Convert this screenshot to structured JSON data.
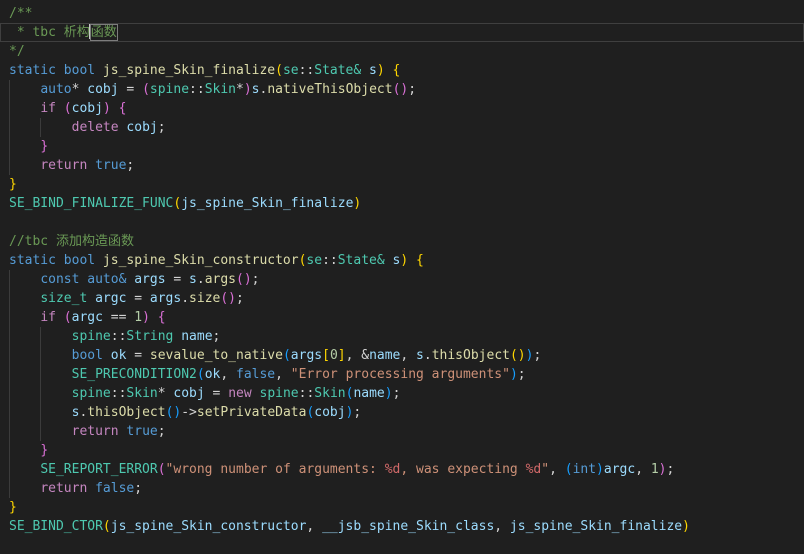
{
  "editor": {
    "description": "dark code editor viewport showing C++ spine Skin JS-binding code, no gutter visible",
    "palette": {
      "bg": "#1f1f1f",
      "fg": "#d4d4d4",
      "guide": "#3b3b3b",
      "lineBorder": "#3f3f3f",
      "cursor": "#c8c8c8",
      "imeBox": "#7d7d7d",
      "cm": "#6a9955",
      "kw": "#569cd6",
      "ct": "#c586c0",
      "fn": "#dcdcaa",
      "ty": "#4ec9b0",
      "vr": "#9cdcfe",
      "nu": "#b5cea8",
      "st": "#ce9178",
      "fm": "#d16969",
      "b1": "#ffd700",
      "b2": "#da70d6",
      "b3": "#179fff"
    },
    "cursor_line": 2,
    "lines": [
      {
        "indent": 0,
        "segments": [
          [
            "cm",
            "/**"
          ]
        ]
      },
      {
        "indent": 0,
        "current": true,
        "segments": [
          [
            "cm",
            " * tbc 析构"
          ],
          [
            "cur",
            ""
          ],
          [
            "cmx",
            "函数"
          ]
        ]
      },
      {
        "indent": 0,
        "segments": [
          [
            "cm",
            "*/"
          ]
        ]
      },
      {
        "indent": 0,
        "segments": [
          [
            "kw",
            "static bool"
          ],
          [
            "pl",
            " "
          ],
          [
            "fn",
            "js_spine_Skin_finalize"
          ],
          [
            "b1",
            "("
          ],
          [
            "ty",
            "se"
          ],
          [
            "pl",
            "::"
          ],
          [
            "ty",
            "State&"
          ],
          [
            "pl",
            " "
          ],
          [
            "vr",
            "s"
          ],
          [
            "b1",
            ")"
          ],
          [
            "pl",
            " "
          ],
          [
            "b1",
            "{"
          ]
        ]
      },
      {
        "indent": 4,
        "segments": [
          [
            "pl",
            "    "
          ],
          [
            "kw",
            "auto"
          ],
          [
            "pl",
            "* "
          ],
          [
            "vr",
            "cobj"
          ],
          [
            "pl",
            " = "
          ],
          [
            "b2",
            "("
          ],
          [
            "ty",
            "spine"
          ],
          [
            "pl",
            "::"
          ],
          [
            "ty",
            "Skin"
          ],
          [
            "pl",
            "*"
          ],
          [
            "b2",
            ")"
          ],
          [
            "vr",
            "s"
          ],
          [
            "pl",
            "."
          ],
          [
            "fn",
            "nativeThisObject"
          ],
          [
            "b2",
            "()"
          ],
          [
            "pl",
            ";"
          ]
        ]
      },
      {
        "indent": 4,
        "segments": [
          [
            "pl",
            "    "
          ],
          [
            "ct",
            "if"
          ],
          [
            "pl",
            " "
          ],
          [
            "b2",
            "("
          ],
          [
            "vr",
            "cobj"
          ],
          [
            "b2",
            ")"
          ],
          [
            "pl",
            " "
          ],
          [
            "b2",
            "{"
          ]
        ]
      },
      {
        "indent": 8,
        "segments": [
          [
            "pl",
            "        "
          ],
          [
            "ct",
            "delete"
          ],
          [
            "pl",
            " "
          ],
          [
            "vr",
            "cobj"
          ],
          [
            "pl",
            ";"
          ]
        ]
      },
      {
        "indent": 4,
        "segments": [
          [
            "pl",
            "    "
          ],
          [
            "b2",
            "}"
          ]
        ]
      },
      {
        "indent": 4,
        "segments": [
          [
            "pl",
            "    "
          ],
          [
            "ct",
            "return"
          ],
          [
            "pl",
            " "
          ],
          [
            "kw",
            "true"
          ],
          [
            "pl",
            ";"
          ]
        ]
      },
      {
        "indent": 0,
        "segments": [
          [
            "b1",
            "}"
          ]
        ]
      },
      {
        "indent": 0,
        "segments": [
          [
            "ty",
            "SE_BIND_FINALIZE_FUNC"
          ],
          [
            "b1",
            "("
          ],
          [
            "vr",
            "js_spine_Skin_finalize"
          ],
          [
            "b1",
            ")"
          ]
        ]
      },
      {
        "indent": 0,
        "segments": []
      },
      {
        "indent": 0,
        "segments": [
          [
            "cm",
            "//tbc 添加构造函数"
          ]
        ]
      },
      {
        "indent": 0,
        "segments": [
          [
            "kw",
            "static bool"
          ],
          [
            "pl",
            " "
          ],
          [
            "fn",
            "js_spine_Skin_constructor"
          ],
          [
            "b1",
            "("
          ],
          [
            "ty",
            "se"
          ],
          [
            "pl",
            "::"
          ],
          [
            "ty",
            "State&"
          ],
          [
            "pl",
            " "
          ],
          [
            "vr",
            "s"
          ],
          [
            "b1",
            ")"
          ],
          [
            "pl",
            " "
          ],
          [
            "b1",
            "{"
          ]
        ]
      },
      {
        "indent": 4,
        "segments": [
          [
            "pl",
            "    "
          ],
          [
            "kw",
            "const auto&"
          ],
          [
            "pl",
            " "
          ],
          [
            "vr",
            "args"
          ],
          [
            "pl",
            " = "
          ],
          [
            "vr",
            "s"
          ],
          [
            "pl",
            "."
          ],
          [
            "fn",
            "args"
          ],
          [
            "b2",
            "()"
          ],
          [
            "pl",
            ";"
          ]
        ]
      },
      {
        "indent": 4,
        "segments": [
          [
            "pl",
            "    "
          ],
          [
            "ty",
            "size_t"
          ],
          [
            "pl",
            " "
          ],
          [
            "vr",
            "argc"
          ],
          [
            "pl",
            " = "
          ],
          [
            "vr",
            "args"
          ],
          [
            "pl",
            "."
          ],
          [
            "fn",
            "size"
          ],
          [
            "b2",
            "()"
          ],
          [
            "pl",
            ";"
          ]
        ]
      },
      {
        "indent": 4,
        "segments": [
          [
            "pl",
            "    "
          ],
          [
            "ct",
            "if"
          ],
          [
            "pl",
            " "
          ],
          [
            "b2",
            "("
          ],
          [
            "vr",
            "argc"
          ],
          [
            "pl",
            " == "
          ],
          [
            "nu",
            "1"
          ],
          [
            "b2",
            ")"
          ],
          [
            "pl",
            " "
          ],
          [
            "b2",
            "{"
          ]
        ]
      },
      {
        "indent": 8,
        "segments": [
          [
            "pl",
            "        "
          ],
          [
            "ty",
            "spine"
          ],
          [
            "pl",
            "::"
          ],
          [
            "ty",
            "String"
          ],
          [
            "pl",
            " "
          ],
          [
            "vr",
            "name"
          ],
          [
            "pl",
            ";"
          ]
        ]
      },
      {
        "indent": 8,
        "segments": [
          [
            "pl",
            "        "
          ],
          [
            "kw",
            "bool"
          ],
          [
            "pl",
            " "
          ],
          [
            "vr",
            "ok"
          ],
          [
            "pl",
            " = "
          ],
          [
            "fn",
            "sevalue_to_native"
          ],
          [
            "b3",
            "("
          ],
          [
            "vr",
            "args"
          ],
          [
            "b1",
            "["
          ],
          [
            "nu",
            "0"
          ],
          [
            "b1",
            "]"
          ],
          [
            "pl",
            ", &"
          ],
          [
            "vr",
            "name"
          ],
          [
            "pl",
            ", "
          ],
          [
            "vr",
            "s"
          ],
          [
            "pl",
            "."
          ],
          [
            "fn",
            "thisObject"
          ],
          [
            "b1",
            "()"
          ],
          [
            "b3",
            ")"
          ],
          [
            "pl",
            ";"
          ]
        ]
      },
      {
        "indent": 8,
        "segments": [
          [
            "pl",
            "        "
          ],
          [
            "ty",
            "SE_PRECONDITION2"
          ],
          [
            "b3",
            "("
          ],
          [
            "vr",
            "ok"
          ],
          [
            "pl",
            ", "
          ],
          [
            "kw",
            "false"
          ],
          [
            "pl",
            ", "
          ],
          [
            "st",
            "\"Error processing arguments\""
          ],
          [
            "b3",
            ")"
          ],
          [
            "pl",
            ";"
          ]
        ]
      },
      {
        "indent": 8,
        "segments": [
          [
            "pl",
            "        "
          ],
          [
            "ty",
            "spine"
          ],
          [
            "pl",
            "::"
          ],
          [
            "ty",
            "Skin"
          ],
          [
            "pl",
            "* "
          ],
          [
            "vr",
            "cobj"
          ],
          [
            "pl",
            " = "
          ],
          [
            "ct",
            "new"
          ],
          [
            "pl",
            " "
          ],
          [
            "ty",
            "spine"
          ],
          [
            "pl",
            "::"
          ],
          [
            "ty",
            "Skin"
          ],
          [
            "b3",
            "("
          ],
          [
            "vr",
            "name"
          ],
          [
            "b3",
            ")"
          ],
          [
            "pl",
            ";"
          ]
        ]
      },
      {
        "indent": 8,
        "segments": [
          [
            "pl",
            "        "
          ],
          [
            "vr",
            "s"
          ],
          [
            "pl",
            "."
          ],
          [
            "fn",
            "thisObject"
          ],
          [
            "b3",
            "()"
          ],
          [
            "pl",
            "->"
          ],
          [
            "fn",
            "setPrivateData"
          ],
          [
            "b3",
            "("
          ],
          [
            "vr",
            "cobj"
          ],
          [
            "b3",
            ")"
          ],
          [
            "pl",
            ";"
          ]
        ]
      },
      {
        "indent": 8,
        "segments": [
          [
            "pl",
            "        "
          ],
          [
            "ct",
            "return"
          ],
          [
            "pl",
            " "
          ],
          [
            "kw",
            "true"
          ],
          [
            "pl",
            ";"
          ]
        ]
      },
      {
        "indent": 4,
        "segments": [
          [
            "pl",
            "    "
          ],
          [
            "b2",
            "}"
          ]
        ]
      },
      {
        "indent": 4,
        "segments": [
          [
            "pl",
            "    "
          ],
          [
            "ty",
            "SE_REPORT_ERROR"
          ],
          [
            "b2",
            "("
          ],
          [
            "st",
            "\"wrong number of arguments: "
          ],
          [
            "fm",
            "%d"
          ],
          [
            "st",
            ", was expecting "
          ],
          [
            "fm",
            "%d"
          ],
          [
            "st",
            "\""
          ],
          [
            "pl",
            ", "
          ],
          [
            "b3",
            "("
          ],
          [
            "kw",
            "int"
          ],
          [
            "b3",
            ")"
          ],
          [
            "vr",
            "argc"
          ],
          [
            "pl",
            ", "
          ],
          [
            "nu",
            "1"
          ],
          [
            "b2",
            ")"
          ],
          [
            "pl",
            ";"
          ]
        ]
      },
      {
        "indent": 4,
        "segments": [
          [
            "pl",
            "    "
          ],
          [
            "ct",
            "return"
          ],
          [
            "pl",
            " "
          ],
          [
            "kw",
            "false"
          ],
          [
            "pl",
            ";"
          ]
        ]
      },
      {
        "indent": 0,
        "segments": [
          [
            "b1",
            "}"
          ]
        ]
      },
      {
        "indent": 0,
        "segments": [
          [
            "ty",
            "SE_BIND_CTOR"
          ],
          [
            "b1",
            "("
          ],
          [
            "vr",
            "js_spine_Skin_constructor"
          ],
          [
            "pl",
            ", "
          ],
          [
            "vr",
            "__jsb_spine_Skin_class"
          ],
          [
            "pl",
            ", "
          ],
          [
            "vr",
            "js_spine_Skin_finalize"
          ],
          [
            "b1",
            ")"
          ]
        ]
      }
    ]
  }
}
